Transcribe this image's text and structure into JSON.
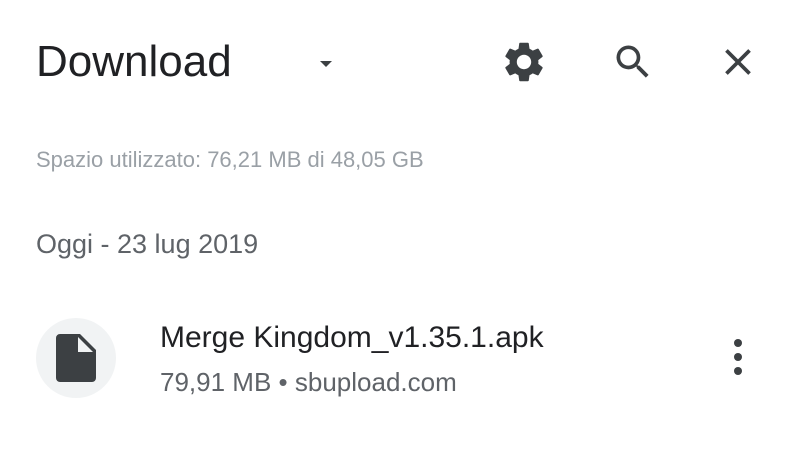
{
  "header": {
    "title": "Download",
    "icons": {
      "dropdown": "arrow-drop-down-icon",
      "settings": "gear-icon",
      "search": "search-icon",
      "close": "close-icon"
    }
  },
  "storage": {
    "text": "Spazio utilizzato: 76,21 MB di 48,05 GB"
  },
  "sections": [
    {
      "header": "Oggi - 23 lug 2019",
      "items": [
        {
          "name": "Merge Kingdom_v1.35.1.apk",
          "size": "79,91 MB",
          "separator": "•",
          "source": "sbupload.com",
          "icon": "file-icon",
          "menu_icon": "more-vert-icon"
        }
      ]
    }
  ],
  "colors": {
    "text_primary": "#202124",
    "text_secondary": "#5f6368",
    "text_hint": "#9aa0a6",
    "icon": "#3c4043",
    "thumb_bg": "#f1f3f4"
  }
}
